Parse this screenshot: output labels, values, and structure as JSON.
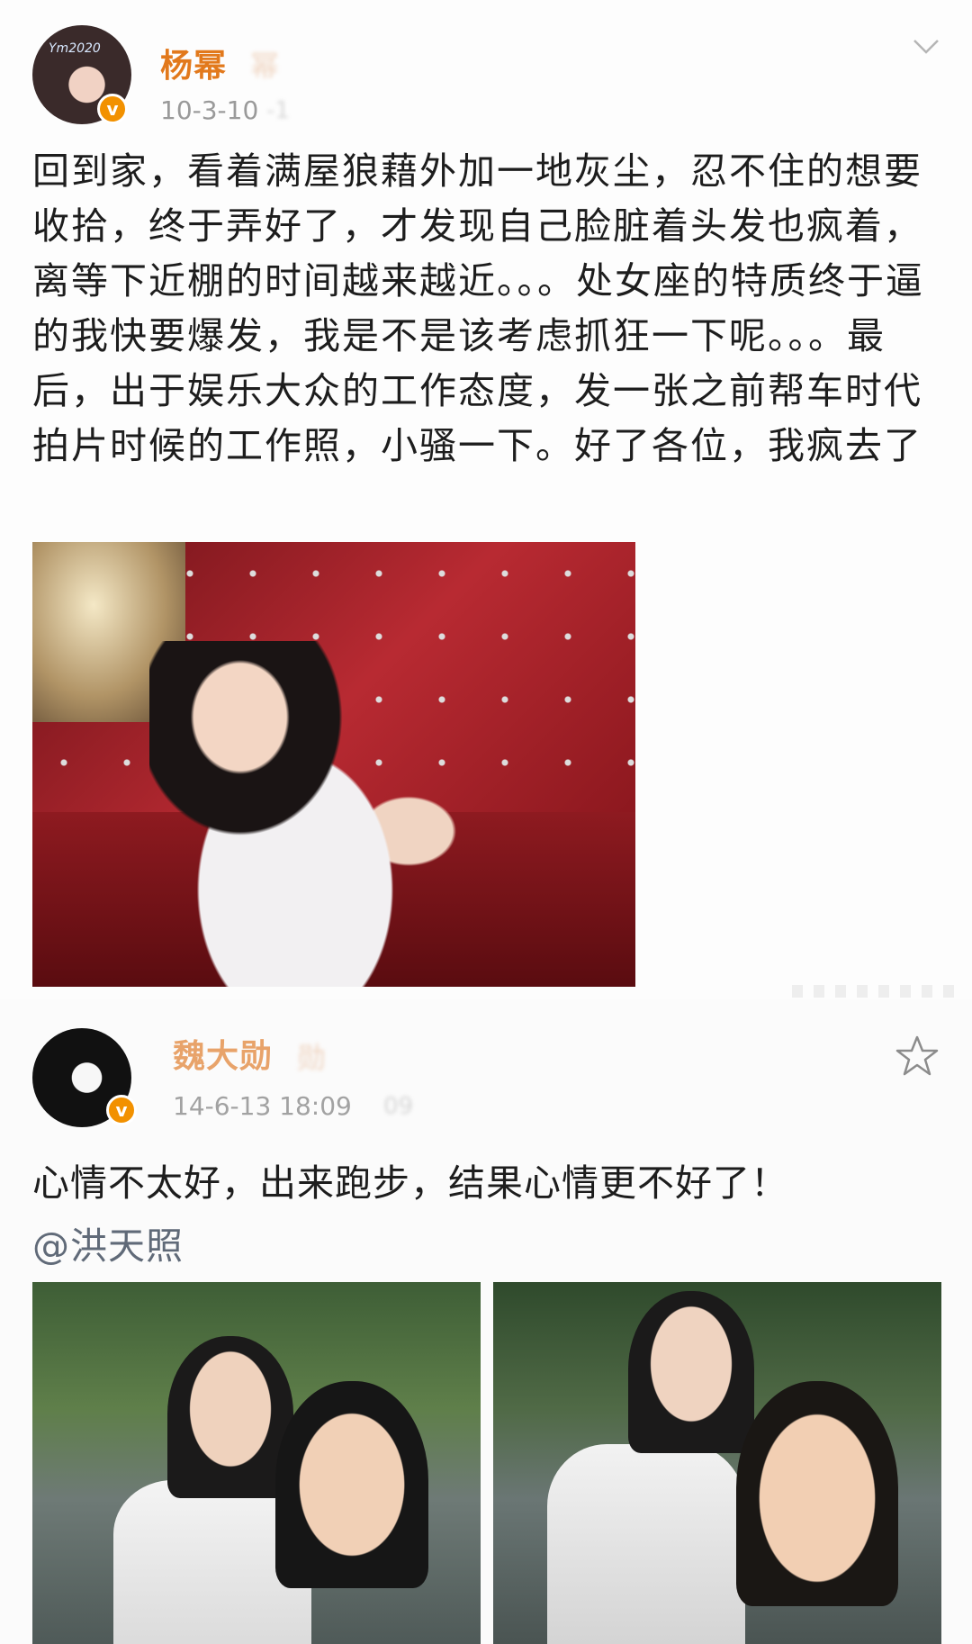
{
  "posts": [
    {
      "username": "杨幂",
      "username_blur": "幂",
      "timestamp": "10-3-10",
      "timestamp_blur": "-1",
      "content": "回到家，看着满屋狼藉外加一地灰尘，忍不住的想要收拾，终于弄好了，才发现自己脸脏着头发也疯着，离等下近棚的时间越来越近。。。处女座的特质终于逼的我快要爆发，我是不是该考虑抓狂一下呢。。。最后，出于娱乐大众的工作态度，发一张之前帮车时代拍片时候的工作照，小骚一下。好了各位，我疯去了",
      "avatar_text": "Ym2020",
      "verified_label": "v",
      "menu_icon": "chevron-down-icon"
    },
    {
      "username": "魏大勋",
      "username_blur": "勋",
      "timestamp": "14-6-13 18:09",
      "timestamp_blur": "09",
      "content": "心情不太好，出来跑步，结果心情更不好了！",
      "mention": "@洪天照",
      "verified_label": "v",
      "menu_icon": "star-icon"
    }
  ]
}
